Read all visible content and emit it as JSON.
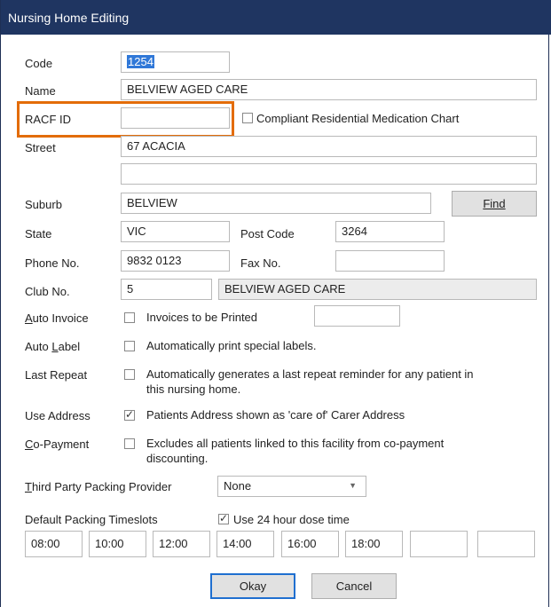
{
  "window": {
    "title": "Nursing Home Editing"
  },
  "form": {
    "code_label": "Code",
    "code_value": "1254",
    "name_label": "Name",
    "name_value": "BELVIEW AGED CARE",
    "racf_label": "RACF ID",
    "racf_value": "",
    "crmc_label": "Compliant Residential Medication Chart",
    "street_label": "Street",
    "street_value_1": "67 ACACIA",
    "street_value_2": "",
    "suburb_label": "Suburb",
    "suburb_value": "BELVIEW",
    "find_label": "Find",
    "state_label": "State",
    "state_value": "VIC",
    "postcode_label": "Post Code",
    "postcode_value": "3264",
    "phone_label": "Phone No.",
    "phone_value": "9832 0123",
    "fax_label": "Fax No.",
    "fax_value": "",
    "club_label": "Club No.",
    "club_value": "5",
    "club_name": "BELVIEW AGED CARE",
    "auto_invoice_label": "Auto Invoice",
    "auto_invoice_text": "Invoices to be Printed",
    "auto_invoice_value": "",
    "auto_label_label": "Auto Label",
    "auto_label_text": "Automatically print special labels.",
    "last_repeat_label": "Last Repeat",
    "last_repeat_text_1": "Automatically generates a last repeat reminder for any patient in",
    "last_repeat_text_2": "this nursing home.",
    "use_address_label": "Use Address",
    "use_address_text": "Patients Address shown as 'care of' Carer Address",
    "copayment_label": "Co-Payment",
    "copayment_text_1": "Excludes all patients linked to this facility from co-payment",
    "copayment_text_2": "discounting.",
    "third_party_label": "Third Party Packing Provider",
    "third_party_value": "None",
    "timeslots_label": "Default Packing Timeslots",
    "dose_time_label": "Use 24 hour dose time",
    "timeslots": [
      "08:00",
      "10:00",
      "12:00",
      "14:00",
      "16:00",
      "18:00",
      "",
      ""
    ]
  },
  "buttons": {
    "okay": "Okay",
    "cancel": "Cancel"
  },
  "checkboxes": {
    "compliant_chart": false,
    "auto_invoice": false,
    "auto_label": false,
    "last_repeat": false,
    "use_address": true,
    "copayment": false,
    "dose_time_24h": true
  },
  "colors": {
    "titlebar": "#1f3561",
    "highlight": "#e36c09",
    "selection": "#3078d8"
  }
}
